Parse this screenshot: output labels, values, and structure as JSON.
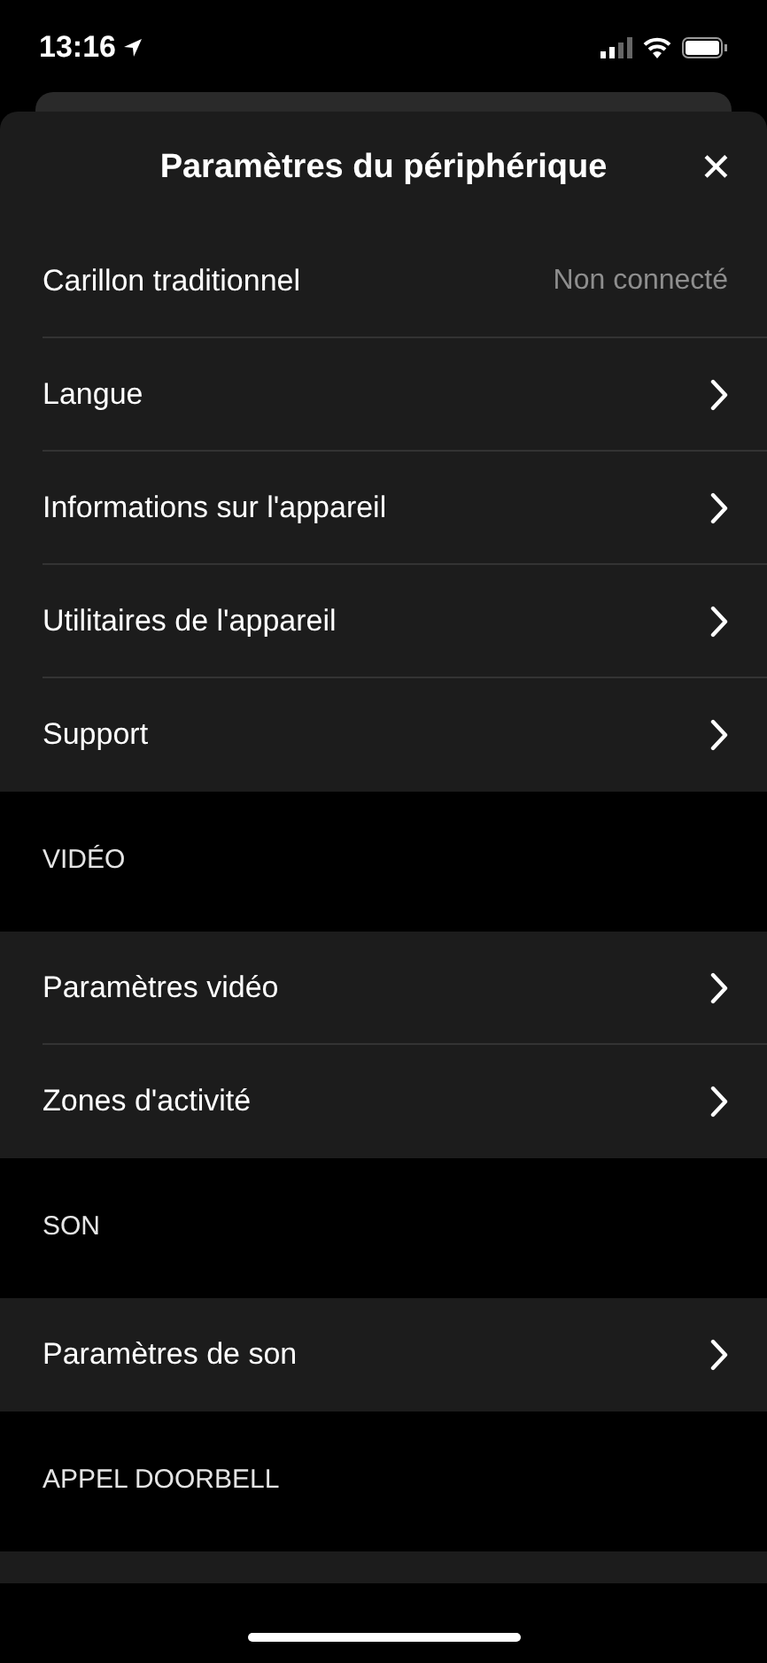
{
  "status_bar": {
    "time": "13:16"
  },
  "sheet": {
    "title": "Paramètres du périphérique",
    "close": "✕"
  },
  "items": [
    {
      "kind": "row",
      "label": "Carillon traditionnel",
      "value": "Non connecté"
    },
    {
      "kind": "row",
      "label": "Langue"
    },
    {
      "kind": "row",
      "label": "Informations sur l'appareil"
    },
    {
      "kind": "row",
      "label": "Utilitaires de l'appareil"
    },
    {
      "kind": "row",
      "label": "Support"
    },
    {
      "kind": "header",
      "label": "VIDÉO"
    },
    {
      "kind": "row",
      "label": "Paramètres vidéo"
    },
    {
      "kind": "row",
      "label": "Zones d'activité"
    },
    {
      "kind": "header",
      "label": "SON"
    },
    {
      "kind": "row",
      "label": "Paramètres de son"
    },
    {
      "kind": "header",
      "label": "APPEL DOORBELL"
    },
    {
      "kind": "cut"
    }
  ]
}
